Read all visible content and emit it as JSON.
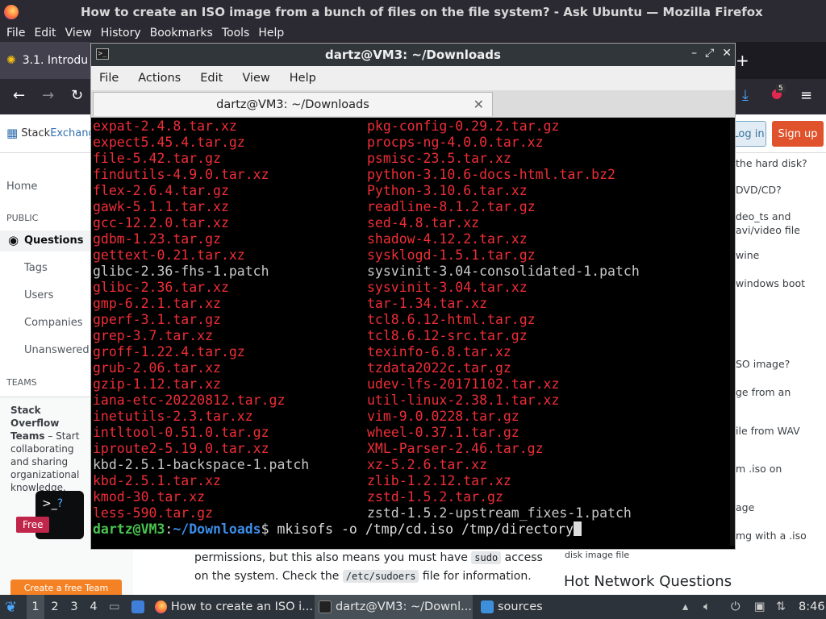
{
  "firefox": {
    "title": "How to create an ISO image from a bunch of files on the file system? - Ask Ubuntu — Mozilla Firefox",
    "menu": [
      "File",
      "Edit",
      "View",
      "History",
      "Bookmarks",
      "Tools",
      "Help"
    ],
    "tab_label": "3.1. Introdu",
    "downloads_badge": "5"
  },
  "site": {
    "logo_a": "Stack",
    "logo_b": "Exchange",
    "login": "Log in",
    "signup": "Sign up",
    "nav": {
      "home": "Home",
      "public": "PUBLIC",
      "questions": "Questions",
      "tags": "Tags",
      "users": "Users",
      "companies": "Companies",
      "unanswered": "Unanswered",
      "teams": "TEAMS"
    },
    "teams_box": {
      "title": "Stack Overflow Teams",
      "text": " – Start collaborating and sharing organizational knowledge.",
      "free": "Free",
      "cta": "Create a free Team"
    },
    "right_items": [
      "the hard disk?",
      "DVD/CD?",
      "deo_ts and",
      "avi/video file",
      "wine",
      "windows boot",
      "SO image?",
      "ge from an",
      "ile from WAV",
      "m .iso on",
      "age",
      "mg with a .iso",
      "disk image file"
    ],
    "hot_network": "Hot Network Questions",
    "body_line1_a": "permissions, but this also means you must have ",
    "body_code1": "sudo",
    "body_line1_b": " access",
    "body_line2_a": "on the system. Check the ",
    "body_code2": "/etc/sudoers",
    "body_line2_b": " file for information."
  },
  "terminal": {
    "title": "dartz@VM3: ~/Downloads",
    "menu": [
      "File",
      "Actions",
      "Edit",
      "View",
      "Help"
    ],
    "tab_title": "dartz@VM3: ~/Downloads",
    "left_col": [
      {
        "t": "expat-2.4.8.tar.xz",
        "k": "arc"
      },
      {
        "t": "expect5.45.4.tar.gz",
        "k": "arc"
      },
      {
        "t": "file-5.42.tar.gz",
        "k": "arc"
      },
      {
        "t": "findutils-4.9.0.tar.xz",
        "k": "arc"
      },
      {
        "t": "flex-2.6.4.tar.gz",
        "k": "arc"
      },
      {
        "t": "gawk-5.1.1.tar.xz",
        "k": "arc"
      },
      {
        "t": "gcc-12.2.0.tar.xz",
        "k": "arc"
      },
      {
        "t": "gdbm-1.23.tar.gz",
        "k": "arc"
      },
      {
        "t": "gettext-0.21.tar.xz",
        "k": "arc"
      },
      {
        "t": "glibc-2.36-fhs-1.patch",
        "k": "pat"
      },
      {
        "t": "glibc-2.36.tar.xz",
        "k": "arc"
      },
      {
        "t": "gmp-6.2.1.tar.xz",
        "k": "arc"
      },
      {
        "t": "gperf-3.1.tar.gz",
        "k": "arc"
      },
      {
        "t": "grep-3.7.tar.xz",
        "k": "arc"
      },
      {
        "t": "groff-1.22.4.tar.gz",
        "k": "arc"
      },
      {
        "t": "grub-2.06.tar.xz",
        "k": "arc"
      },
      {
        "t": "gzip-1.12.tar.xz",
        "k": "arc"
      },
      {
        "t": "iana-etc-20220812.tar.gz",
        "k": "arc"
      },
      {
        "t": "inetutils-2.3.tar.xz",
        "k": "arc"
      },
      {
        "t": "intltool-0.51.0.tar.gz",
        "k": "arc"
      },
      {
        "t": "iproute2-5.19.0.tar.xz",
        "k": "arc"
      },
      {
        "t": "kbd-2.5.1-backspace-1.patch",
        "k": "pat"
      },
      {
        "t": "kbd-2.5.1.tar.xz",
        "k": "arc"
      },
      {
        "t": "kmod-30.tar.xz",
        "k": "arc"
      },
      {
        "t": "less-590.tar.gz",
        "k": "arc"
      }
    ],
    "right_col": [
      {
        "t": "pkg-config-0.29.2.tar.gz",
        "k": "arc"
      },
      {
        "t": "procps-ng-4.0.0.tar.xz",
        "k": "arc"
      },
      {
        "t": "psmisc-23.5.tar.xz",
        "k": "arc"
      },
      {
        "t": "python-3.10.6-docs-html.tar.bz2",
        "k": "arc"
      },
      {
        "t": "Python-3.10.6.tar.xz",
        "k": "arc"
      },
      {
        "t": "readline-8.1.2.tar.gz",
        "k": "arc"
      },
      {
        "t": "sed-4.8.tar.xz",
        "k": "arc"
      },
      {
        "t": "shadow-4.12.2.tar.xz",
        "k": "arc"
      },
      {
        "t": "sysklogd-1.5.1.tar.gz",
        "k": "arc"
      },
      {
        "t": "sysvinit-3.04-consolidated-1.patch",
        "k": "pat"
      },
      {
        "t": "sysvinit-3.04.tar.xz",
        "k": "arc"
      },
      {
        "t": "tar-1.34.tar.xz",
        "k": "arc"
      },
      {
        "t": "tcl8.6.12-html.tar.gz",
        "k": "arc"
      },
      {
        "t": "tcl8.6.12-src.tar.gz",
        "k": "arc"
      },
      {
        "t": "texinfo-6.8.tar.xz",
        "k": "arc"
      },
      {
        "t": "tzdata2022c.tar.gz",
        "k": "arc"
      },
      {
        "t": "udev-lfs-20171102.tar.xz",
        "k": "arc"
      },
      {
        "t": "util-linux-2.38.1.tar.xz",
        "k": "arc"
      },
      {
        "t": "vim-9.0.0228.tar.gz",
        "k": "arc"
      },
      {
        "t": "wheel-0.37.1.tar.gz",
        "k": "arc"
      },
      {
        "t": "XML-Parser-2.46.tar.gz",
        "k": "arc"
      },
      {
        "t": "xz-5.2.6.tar.xz",
        "k": "arc"
      },
      {
        "t": "zlib-1.2.12.tar.xz",
        "k": "arc"
      },
      {
        "t": "zstd-1.5.2.tar.gz",
        "k": "arc"
      },
      {
        "t": "zstd-1.5.2-upstream_fixes-1.patch",
        "k": "pat"
      }
    ],
    "prompt_user": "dartz@VM3",
    "prompt_sep": ":",
    "prompt_path": "~/Downloads",
    "prompt_sym": "$ ",
    "command": "mkisofs -o /tmp/cd.iso /tmp/directory"
  },
  "taskbar": {
    "workspaces": [
      "1",
      "2",
      "3",
      "4"
    ],
    "tasks": [
      "How to create an ISO i...",
      "dartz@VM3: ~/Downl...",
      "sources"
    ],
    "clock": "8:46"
  }
}
